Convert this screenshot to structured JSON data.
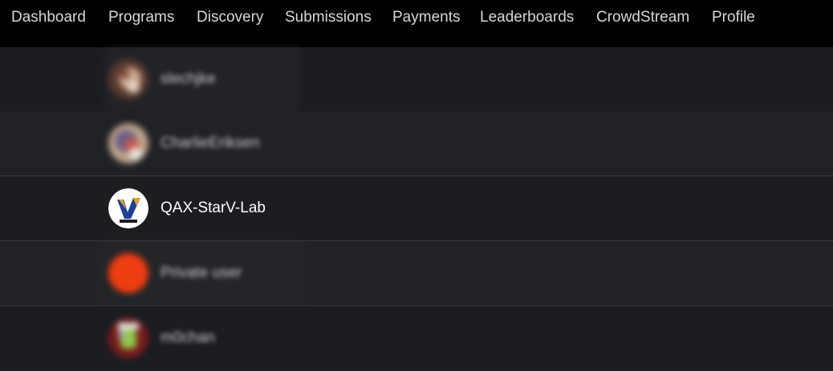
{
  "nav": {
    "items": [
      {
        "label": "Dashboard"
      },
      {
        "label": "Programs"
      },
      {
        "label": "Discovery"
      },
      {
        "label": "Submissions"
      },
      {
        "label": "Payments"
      },
      {
        "label": "Leaderboards"
      },
      {
        "label": "CrowdStream"
      },
      {
        "label": "Profile"
      }
    ]
  },
  "leaderboard": {
    "rows": [
      {
        "username": "slechjke",
        "avatar": "user-avatar-icon",
        "blurred": true
      },
      {
        "username": "CharlieEriksen",
        "avatar": "user-avatar-icon",
        "blurred": true
      },
      {
        "username": "QAX-StarV-Lab",
        "avatar": "starv-lab-logo-icon",
        "blurred": false
      },
      {
        "username": "Private user",
        "avatar": "private-user-avatar-icon",
        "blurred": true
      },
      {
        "username": "m0chan",
        "avatar": "user-avatar-icon",
        "blurred": true
      }
    ]
  },
  "colors": {
    "nav_bg": "#000000",
    "nav_text": "#d5d8dc",
    "row_bg": "#1e2024",
    "row_border": "#3a3d42",
    "private_avatar": "#ee3d10"
  }
}
